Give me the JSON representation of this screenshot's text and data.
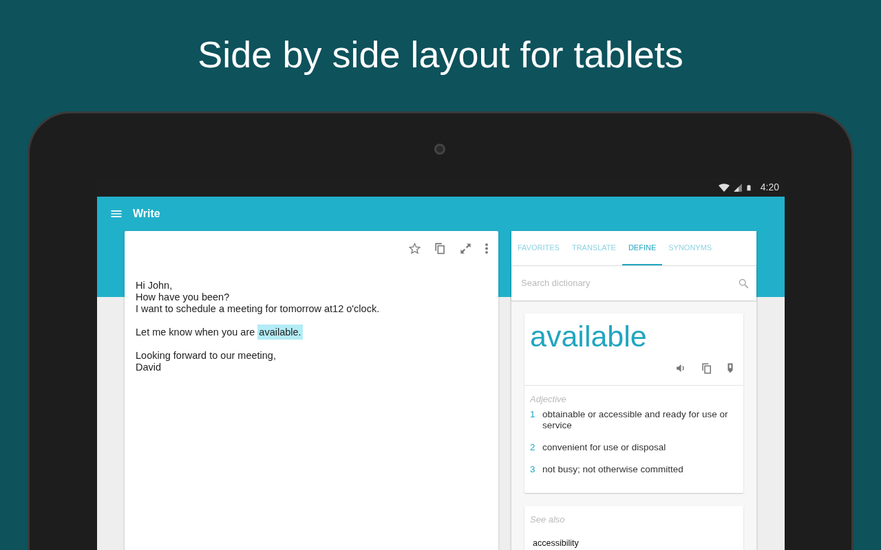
{
  "headline": "Side by side layout for tablets",
  "status_bar": {
    "time": "4:20"
  },
  "toolbar": {
    "title": "Write"
  },
  "editor": {
    "paragraphs": [
      {
        "text": "Hi John,\nHow have you been?\nI want to schedule a meeting for tomorrow at12 o'clock."
      },
      {
        "text": "Let me know when you are ",
        "highlight": "available."
      },
      {
        "text": "Looking forward to our meeting,\nDavid"
      }
    ]
  },
  "dictionary": {
    "tabs": [
      {
        "label": "FAVORITES",
        "selected": false
      },
      {
        "label": "TRANSLATE",
        "selected": false
      },
      {
        "label": "DEFINE",
        "selected": true
      },
      {
        "label": "SYNONYMS",
        "selected": false
      }
    ],
    "search": {
      "placeholder": "Search dictionary"
    },
    "word": "available",
    "part_of_speech": "Adjective",
    "definitions": [
      {
        "number": "1",
        "text": "obtainable or accessible and ready for use or service"
      },
      {
        "number": "2",
        "text": "convenient for use or disposal"
      },
      {
        "number": "3",
        "text": "not busy; not otherwise committed"
      }
    ],
    "see_also": {
      "heading": "See also",
      "items": [
        "accessibility"
      ]
    }
  }
}
